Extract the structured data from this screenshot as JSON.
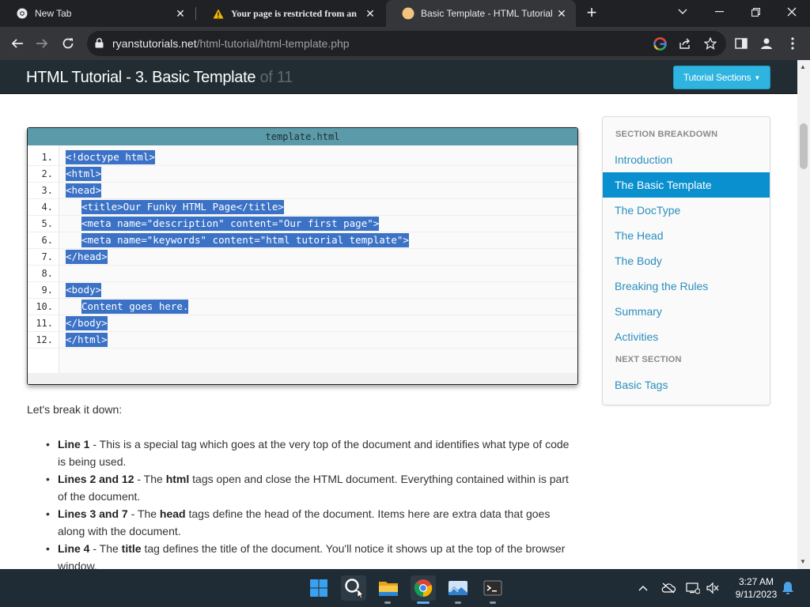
{
  "browser": {
    "tabs": [
      {
        "title": "New Tab"
      },
      {
        "title": "Your page is restricted from an"
      },
      {
        "title": "Basic Template - HTML Tutorial"
      }
    ],
    "address": {
      "host": "ryanstutorials.net",
      "path": "/html-tutorial/html-template.php"
    }
  },
  "page": {
    "title": "HTML Tutorial - 3. Basic Template",
    "of_total": "of 11",
    "sections_button": "Tutorial Sections",
    "code": {
      "filename": "template.html",
      "lines": [
        {
          "num": "1.",
          "text": "<!doctype html>",
          "indent": false
        },
        {
          "num": "2.",
          "text": "<html>",
          "indent": false
        },
        {
          "num": "3.",
          "text": "<head>",
          "indent": false
        },
        {
          "num": "4.",
          "text": "<title>Our Funky HTML Page</title>",
          "indent": true
        },
        {
          "num": "5.",
          "text": "<meta name=\"description\" content=\"Our first page\">",
          "indent": true
        },
        {
          "num": "6.",
          "text": "<meta name=\"keywords\" content=\"html tutorial template\">",
          "indent": true
        },
        {
          "num": "7.",
          "text": "</head>",
          "indent": false
        },
        {
          "num": "8.",
          "text": "",
          "indent": false
        },
        {
          "num": "9.",
          "text": "<body>",
          "indent": false
        },
        {
          "num": "10.",
          "text": "Content goes here.",
          "indent": true
        },
        {
          "num": "11.",
          "text": "</body>",
          "indent": false
        },
        {
          "num": "12.",
          "text": "</html>",
          "indent": false
        }
      ]
    },
    "intro": "Let's break it down:",
    "points": [
      {
        "lead": "Line 1",
        "parts": [
          " - This is a special tag which goes at the very top of the document and identifies what type of code is being used."
        ]
      },
      {
        "lead": "Lines 2 and 12",
        "parts": [
          " - The ",
          "html",
          " tags open and close the HTML document. Everything contained within is part of the document."
        ]
      },
      {
        "lead": "Lines 3 and 7",
        "parts": [
          " - The ",
          "head",
          " tags define the head of the document. Items here are extra data that goes along with the document."
        ]
      },
      {
        "lead": "Line 4",
        "parts": [
          " - The ",
          "title",
          " tag defines the title of the document. You'll notice it shows up at the top of the browser window."
        ]
      }
    ],
    "sidebar": {
      "section_heading": "SECTION BREAKDOWN",
      "items": [
        "Introduction",
        "The Basic Template",
        "The DocType",
        "The Head",
        "The Body",
        "Breaking the Rules",
        "Summary",
        "Activities"
      ],
      "active_index": 1,
      "next_heading": "NEXT SECTION",
      "next_item": "Basic Tags"
    }
  },
  "taskbar": {
    "time": "3:27 AM",
    "date": "9/11/2023"
  },
  "colors": {
    "header_bg": "#222d33",
    "accent": "#2fb4e0",
    "active_item": "#0a8fcf",
    "link": "#2a8fbd",
    "code_highlight": "#3b72c6"
  }
}
